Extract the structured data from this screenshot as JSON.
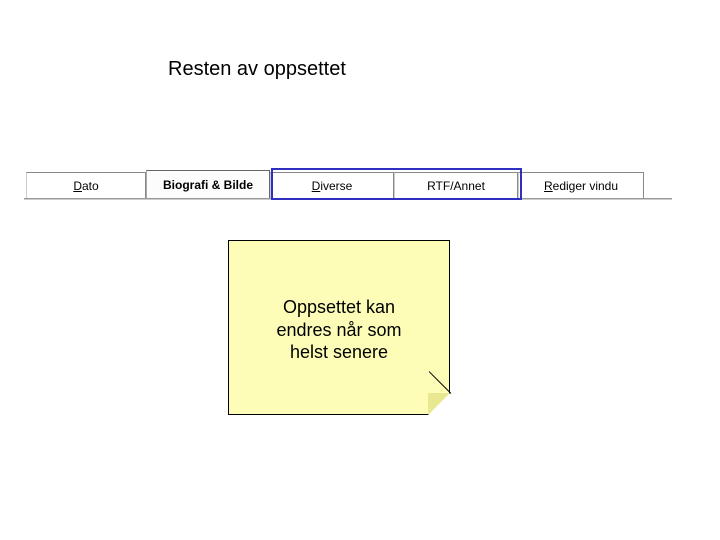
{
  "title": "Resten av oppsettet",
  "tabs": {
    "dato": {
      "prefix": "D",
      "rest": "ato"
    },
    "biografi": {
      "label": "Biografi & Bilde"
    },
    "diverse": {
      "prefix": "D",
      "rest": "iverse"
    },
    "rtf": {
      "label": "RTF/Annet"
    },
    "rediger": {
      "prefix": "R",
      "rest": "ediger vindu"
    }
  },
  "note": {
    "line1": "Oppsettet kan",
    "line2": "endres når som",
    "line3": "helst senere"
  }
}
